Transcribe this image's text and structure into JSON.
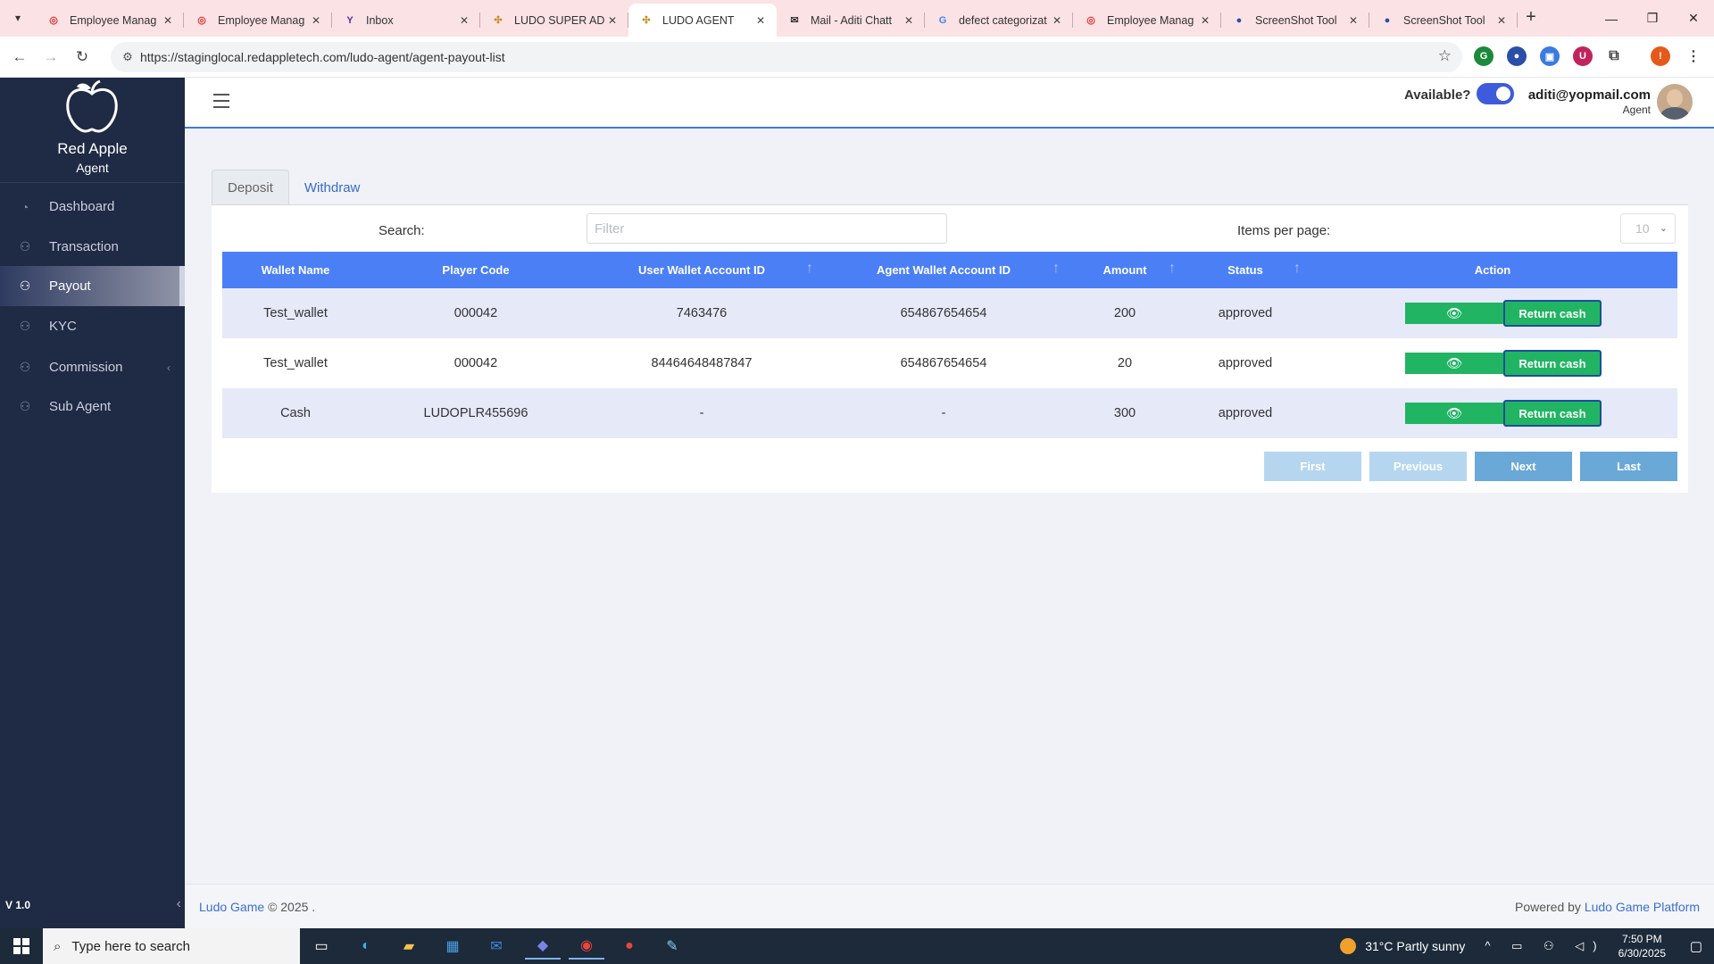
{
  "browser": {
    "tabs": [
      {
        "title": "Employee Manag",
        "icon": "pdf-icon",
        "active": false
      },
      {
        "title": "Employee Manag",
        "icon": "pdf-icon",
        "active": false
      },
      {
        "title": "Inbox",
        "icon": "yahoo-icon",
        "active": false
      },
      {
        "title": "LUDO SUPER ADI",
        "icon": "ludo-icon",
        "active": false
      },
      {
        "title": "LUDO AGENT",
        "icon": "ludo-icon",
        "active": true
      },
      {
        "title": "Mail - Aditi Chatt",
        "icon": "mail-icon",
        "active": false
      },
      {
        "title": "defect categorizat",
        "icon": "google-icon",
        "active": false
      },
      {
        "title": "Employee Manag",
        "icon": "pdf-icon",
        "active": false
      },
      {
        "title": "ScreenShot Tool",
        "icon": "screenshot-icon",
        "active": false
      },
      {
        "title": "ScreenShot Tool",
        "icon": "screenshot-icon",
        "active": false
      }
    ],
    "url": "https://staginglocal.redappletech.com/ludo-agent/agent-payout-list"
  },
  "sidebar": {
    "brand": "Red Apple",
    "subtitle": "Agent",
    "items": [
      {
        "label": "Dashboard",
        "icon": "dashboard-icon"
      },
      {
        "label": "Transaction",
        "icon": "transaction-icon"
      },
      {
        "label": "Payout",
        "icon": "payout-icon"
      },
      {
        "label": "KYC",
        "icon": "kyc-icon"
      },
      {
        "label": "Commission",
        "icon": "commission-icon"
      },
      {
        "label": "Sub Agent",
        "icon": "sub-agent-icon"
      }
    ],
    "active_item": "Payout",
    "version": "V 1.0"
  },
  "header": {
    "available_label": "Available?",
    "available": true,
    "email": "aditi@yopmail.com",
    "role": "Agent"
  },
  "content": {
    "tabs": [
      "Deposit",
      "Withdraw"
    ],
    "active_tab": "Deposit",
    "search_label": "Search:",
    "search_placeholder": "Filter",
    "items_per_page_label": "Items per page:",
    "items_per_page": "10",
    "table": {
      "columns": [
        "Wallet Name",
        "Player Code",
        "User Wallet Account ID",
        "Agent Wallet Account ID",
        "Amount",
        "Status",
        "Action"
      ],
      "rows": [
        {
          "wallet_name": "Test_wallet",
          "player_code": "000042",
          "user_wallet_id": "7463476",
          "agent_wallet_id": "654867654654",
          "amount": "200",
          "status": "approved"
        },
        {
          "wallet_name": "Test_wallet",
          "player_code": "000042",
          "user_wallet_id": "84464648487847",
          "agent_wallet_id": "654867654654",
          "amount": "20",
          "status": "approved"
        },
        {
          "wallet_name": "Cash",
          "player_code": "LUDOPLR455696",
          "user_wallet_id": "-",
          "agent_wallet_id": "-",
          "amount": "300",
          "status": "approved"
        }
      ],
      "return_cash_label": "Return cash"
    },
    "pagination": {
      "first": "First",
      "previous": "Previous",
      "next": "Next",
      "last": "Last"
    }
  },
  "footer": {
    "link": "Ludo Game",
    "copyright": "© 2025 .",
    "powered_by": "Powered by",
    "powered_link": "Ludo Game Platform"
  },
  "taskbar": {
    "search_placeholder": "Type here to search",
    "weather": "31°C  Partly sunny",
    "time": "7:50 PM",
    "date": "6/30/2025"
  },
  "colors": {
    "sidebar_bg": "#1f2a44",
    "table_header": "#4b7ff5",
    "action_green": "#21b463",
    "tab_strip": "#fbe2e4"
  }
}
